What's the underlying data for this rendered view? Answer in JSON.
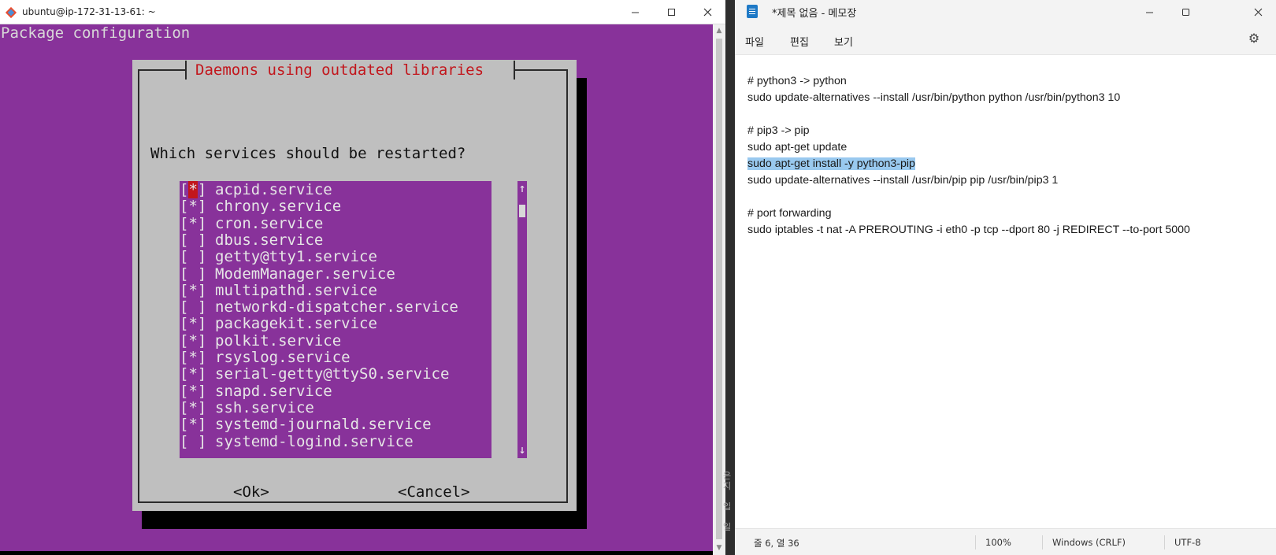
{
  "terminal": {
    "title": "ubuntu@ip-172-31-13-61: ~",
    "header": "Package configuration",
    "dialog": {
      "title": "Daemons using outdated libraries",
      "question": "Which services should be restarted?",
      "services": [
        {
          "check_open": "[",
          "check_mark": "*",
          "check_close": "]",
          "name": "acpid.service",
          "selected": true
        },
        {
          "check": "[*]",
          "name": "chrony.service"
        },
        {
          "check": "[*]",
          "name": "cron.service"
        },
        {
          "check": "[ ]",
          "name": "dbus.service"
        },
        {
          "check": "[ ]",
          "name": "getty@tty1.service"
        },
        {
          "check": "[ ]",
          "name": "ModemManager.service"
        },
        {
          "check": "[*]",
          "name": "multipathd.service"
        },
        {
          "check": "[ ]",
          "name": "networkd-dispatcher.service"
        },
        {
          "check": "[*]",
          "name": "packagekit.service"
        },
        {
          "check": "[*]",
          "name": "polkit.service"
        },
        {
          "check": "[*]",
          "name": "rsyslog.service"
        },
        {
          "check": "[*]",
          "name": "serial-getty@ttyS0.service"
        },
        {
          "check": "[*]",
          "name": "snapd.service"
        },
        {
          "check": "[*]",
          "name": "ssh.service"
        },
        {
          "check": "[*]",
          "name": "systemd-journald.service"
        },
        {
          "check": "[ ]",
          "name": "systemd-logind.service"
        }
      ],
      "scroll_up": "↑",
      "scroll_down": "↓",
      "ok_label": "<Ok>",
      "cancel_label": "<Cancel>"
    },
    "colors": {
      "background": "#88329a",
      "dialog": "#bfbfbf",
      "title_red": "#c2161c"
    }
  },
  "gap_text": "은\n지\n\n입\n\n일",
  "notepad": {
    "title": "*제목 없음 - 메모장",
    "menu": [
      "파일",
      "편집",
      "보기"
    ],
    "lines": [
      "",
      "# python3 -> python",
      "sudo update-alternatives --install /usr/bin/python python /usr/bin/python3 10",
      "",
      "# pip3 -> pip",
      "sudo apt-get update",
      "sudo apt-get install -y python3-pip",
      "sudo update-alternatives --install /usr/bin/pip pip /usr/bin/pip3 1",
      "",
      "# port forwarding",
      "sudo iptables -t nat -A PREROUTING -i eth0 -p tcp --dport 80 -j REDIRECT --to-port 5000"
    ],
    "status": {
      "position": "줄 6, 열 36",
      "zoom": "100%",
      "line_ending": "Windows (CRLF)",
      "encoding": "UTF-8"
    },
    "colors": {
      "selection": "#99c9ef"
    }
  }
}
